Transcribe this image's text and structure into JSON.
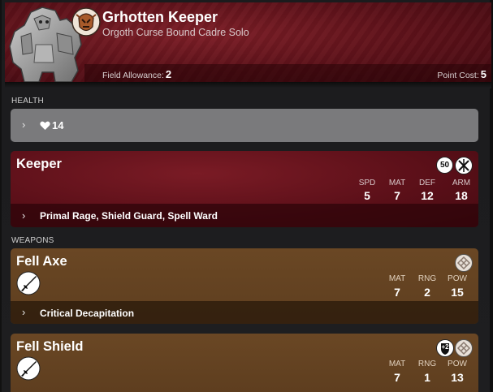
{
  "header": {
    "title": "Grhotten Keeper",
    "subtitle": "Orgoth Curse Bound Cadre Solo",
    "field_allowance_label": "Field Allowance:",
    "field_allowance_value": "2",
    "point_cost_label": "Point Cost:",
    "point_cost_value": "5"
  },
  "health": {
    "section_label": "HEALTH",
    "icon": "heart-icon",
    "value": "14"
  },
  "model": {
    "name": "Keeper",
    "badges": [
      {
        "text": "50",
        "name": "base-size-badge"
      },
      {
        "icon": "crossed-weapons-icon"
      }
    ],
    "stats": [
      {
        "label": "SPD",
        "value": "5"
      },
      {
        "label": "MAT",
        "value": "7"
      },
      {
        "label": "DEF",
        "value": "12"
      },
      {
        "label": "ARM",
        "value": "18"
      }
    ],
    "abilities": "Primal Rage, Shield Guard, Spell Ward"
  },
  "weapons": {
    "section_label": "WEAPONS",
    "items": [
      {
        "name": "Fell Axe",
        "icon": "melee-blade-icon",
        "quality_icons": [
          "weapon-quality-icon"
        ],
        "stats": [
          {
            "label": "MAT",
            "value": "7"
          },
          {
            "label": "RNG",
            "value": "2"
          },
          {
            "label": "POW",
            "value": "15"
          }
        ],
        "abilities": "Critical Decapitation"
      },
      {
        "name": "Fell Shield",
        "icon": "melee-blade-icon",
        "quality_icons": [
          "shield-bonus-icon",
          "weapon-quality-icon"
        ],
        "shield_bonus": "+2",
        "stats": [
          {
            "label": "MAT",
            "value": "7"
          },
          {
            "label": "RNG",
            "value": "1"
          },
          {
            "label": "POW",
            "value": "13"
          }
        ]
      }
    ]
  },
  "colors": {
    "header_red": "#5c1119",
    "weapon_brown": "#6a4724",
    "health_gray": "#7a7a7c"
  }
}
